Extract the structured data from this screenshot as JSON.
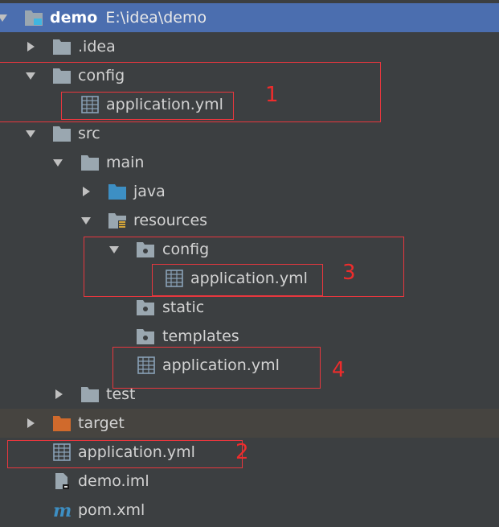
{
  "colors": {
    "background": "#3c3f41",
    "selection": "#4b6eaf",
    "excluded_row": "#464440",
    "annotation": "#e8373e",
    "text": "#d3d3d3"
  },
  "tree": {
    "root": {
      "name": "demo",
      "path": "E:\\idea\\demo",
      "icon": "module-folder-icon"
    },
    "items": [
      {
        "label": ".idea",
        "icon": "folder-icon"
      },
      {
        "label": "config",
        "icon": "folder-icon"
      },
      {
        "label": "application.yml",
        "icon": "yaml-file-icon"
      },
      {
        "label": "src",
        "icon": "folder-icon"
      },
      {
        "label": "main",
        "icon": "folder-icon"
      },
      {
        "label": "java",
        "icon": "source-folder-icon"
      },
      {
        "label": "resources",
        "icon": "resources-folder-icon"
      },
      {
        "label": "config",
        "icon": "package-folder-icon"
      },
      {
        "label": "application.yml",
        "icon": "yaml-file-icon"
      },
      {
        "label": "static",
        "icon": "package-folder-icon"
      },
      {
        "label": "templates",
        "icon": "package-folder-icon"
      },
      {
        "label": "application.yml",
        "icon": "yaml-file-icon"
      },
      {
        "label": "test",
        "icon": "folder-icon"
      },
      {
        "label": "target",
        "icon": "excluded-folder-icon"
      },
      {
        "label": "application.yml",
        "icon": "yaml-file-icon"
      },
      {
        "label": "demo.iml",
        "icon": "iml-file-icon"
      },
      {
        "label": "pom.xml",
        "icon": "maven-icon"
      }
    ]
  },
  "annotations": {
    "n1": "1",
    "n2": "2",
    "n3": "3",
    "n4": "4"
  }
}
